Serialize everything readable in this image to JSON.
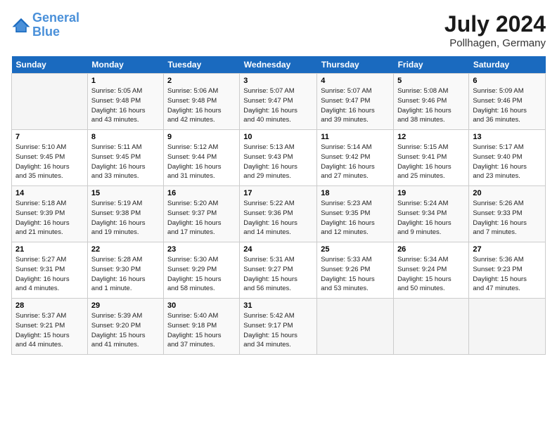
{
  "logo": {
    "line1": "General",
    "line2": "Blue"
  },
  "title": "July 2024",
  "location": "Pollhagen, Germany",
  "days_header": [
    "Sunday",
    "Monday",
    "Tuesday",
    "Wednesday",
    "Thursday",
    "Friday",
    "Saturday"
  ],
  "weeks": [
    [
      {
        "num": "",
        "info": ""
      },
      {
        "num": "1",
        "info": "Sunrise: 5:05 AM\nSunset: 9:48 PM\nDaylight: 16 hours\nand 43 minutes."
      },
      {
        "num": "2",
        "info": "Sunrise: 5:06 AM\nSunset: 9:48 PM\nDaylight: 16 hours\nand 42 minutes."
      },
      {
        "num": "3",
        "info": "Sunrise: 5:07 AM\nSunset: 9:47 PM\nDaylight: 16 hours\nand 40 minutes."
      },
      {
        "num": "4",
        "info": "Sunrise: 5:07 AM\nSunset: 9:47 PM\nDaylight: 16 hours\nand 39 minutes."
      },
      {
        "num": "5",
        "info": "Sunrise: 5:08 AM\nSunset: 9:46 PM\nDaylight: 16 hours\nand 38 minutes."
      },
      {
        "num": "6",
        "info": "Sunrise: 5:09 AM\nSunset: 9:46 PM\nDaylight: 16 hours\nand 36 minutes."
      }
    ],
    [
      {
        "num": "7",
        "info": "Sunrise: 5:10 AM\nSunset: 9:45 PM\nDaylight: 16 hours\nand 35 minutes."
      },
      {
        "num": "8",
        "info": "Sunrise: 5:11 AM\nSunset: 9:45 PM\nDaylight: 16 hours\nand 33 minutes."
      },
      {
        "num": "9",
        "info": "Sunrise: 5:12 AM\nSunset: 9:44 PM\nDaylight: 16 hours\nand 31 minutes."
      },
      {
        "num": "10",
        "info": "Sunrise: 5:13 AM\nSunset: 9:43 PM\nDaylight: 16 hours\nand 29 minutes."
      },
      {
        "num": "11",
        "info": "Sunrise: 5:14 AM\nSunset: 9:42 PM\nDaylight: 16 hours\nand 27 minutes."
      },
      {
        "num": "12",
        "info": "Sunrise: 5:15 AM\nSunset: 9:41 PM\nDaylight: 16 hours\nand 25 minutes."
      },
      {
        "num": "13",
        "info": "Sunrise: 5:17 AM\nSunset: 9:40 PM\nDaylight: 16 hours\nand 23 minutes."
      }
    ],
    [
      {
        "num": "14",
        "info": "Sunrise: 5:18 AM\nSunset: 9:39 PM\nDaylight: 16 hours\nand 21 minutes."
      },
      {
        "num": "15",
        "info": "Sunrise: 5:19 AM\nSunset: 9:38 PM\nDaylight: 16 hours\nand 19 minutes."
      },
      {
        "num": "16",
        "info": "Sunrise: 5:20 AM\nSunset: 9:37 PM\nDaylight: 16 hours\nand 17 minutes."
      },
      {
        "num": "17",
        "info": "Sunrise: 5:22 AM\nSunset: 9:36 PM\nDaylight: 16 hours\nand 14 minutes."
      },
      {
        "num": "18",
        "info": "Sunrise: 5:23 AM\nSunset: 9:35 PM\nDaylight: 16 hours\nand 12 minutes."
      },
      {
        "num": "19",
        "info": "Sunrise: 5:24 AM\nSunset: 9:34 PM\nDaylight: 16 hours\nand 9 minutes."
      },
      {
        "num": "20",
        "info": "Sunrise: 5:26 AM\nSunset: 9:33 PM\nDaylight: 16 hours\nand 7 minutes."
      }
    ],
    [
      {
        "num": "21",
        "info": "Sunrise: 5:27 AM\nSunset: 9:31 PM\nDaylight: 16 hours\nand 4 minutes."
      },
      {
        "num": "22",
        "info": "Sunrise: 5:28 AM\nSunset: 9:30 PM\nDaylight: 16 hours\nand 1 minute."
      },
      {
        "num": "23",
        "info": "Sunrise: 5:30 AM\nSunset: 9:29 PM\nDaylight: 15 hours\nand 58 minutes."
      },
      {
        "num": "24",
        "info": "Sunrise: 5:31 AM\nSunset: 9:27 PM\nDaylight: 15 hours\nand 56 minutes."
      },
      {
        "num": "25",
        "info": "Sunrise: 5:33 AM\nSunset: 9:26 PM\nDaylight: 15 hours\nand 53 minutes."
      },
      {
        "num": "26",
        "info": "Sunrise: 5:34 AM\nSunset: 9:24 PM\nDaylight: 15 hours\nand 50 minutes."
      },
      {
        "num": "27",
        "info": "Sunrise: 5:36 AM\nSunset: 9:23 PM\nDaylight: 15 hours\nand 47 minutes."
      }
    ],
    [
      {
        "num": "28",
        "info": "Sunrise: 5:37 AM\nSunset: 9:21 PM\nDaylight: 15 hours\nand 44 minutes."
      },
      {
        "num": "29",
        "info": "Sunrise: 5:39 AM\nSunset: 9:20 PM\nDaylight: 15 hours\nand 41 minutes."
      },
      {
        "num": "30",
        "info": "Sunrise: 5:40 AM\nSunset: 9:18 PM\nDaylight: 15 hours\nand 37 minutes."
      },
      {
        "num": "31",
        "info": "Sunrise: 5:42 AM\nSunset: 9:17 PM\nDaylight: 15 hours\nand 34 minutes."
      },
      {
        "num": "",
        "info": ""
      },
      {
        "num": "",
        "info": ""
      },
      {
        "num": "",
        "info": ""
      }
    ]
  ]
}
